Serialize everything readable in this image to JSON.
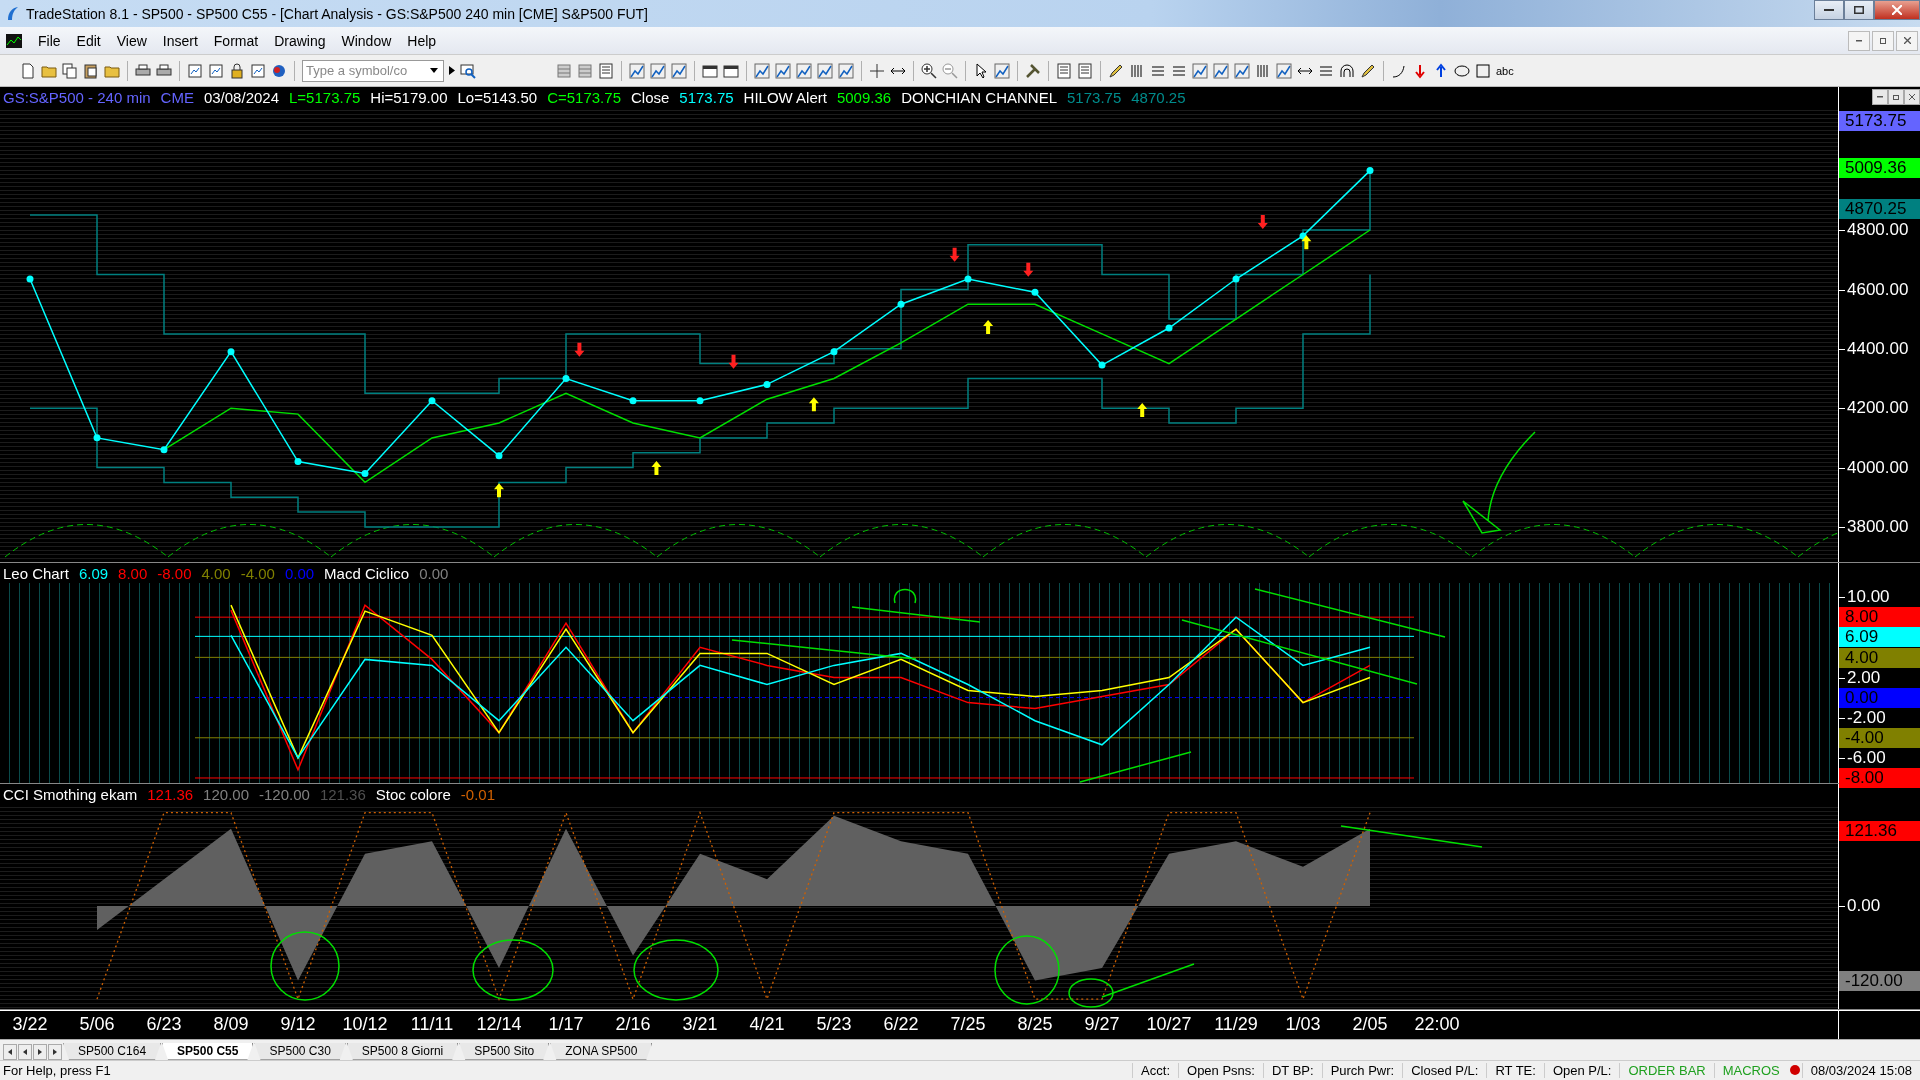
{
  "window": {
    "title": "TradeStation 8.1 - SP500 - SP500 C55 - [Chart Analysis - GS:S&P500  240 min  [CME] S&P500 FUT]"
  },
  "menu": [
    "File",
    "Edit",
    "View",
    "Insert",
    "Format",
    "Drawing",
    "Window",
    "Help"
  ],
  "toolbar": {
    "symbol_field": {
      "placeholder": "Type a symbol/co"
    },
    "text_tool": "abc"
  },
  "panes": [
    {
      "legend": [
        {
          "text": "GS:S&P500 - 240 min",
          "color": "#6464ff"
        },
        {
          "text": "CME",
          "color": "#6464ff"
        },
        {
          "text": "03/08/2024",
          "color": "#ffffff"
        },
        {
          "text": "L=5173.75",
          "color": "#00ff00"
        },
        {
          "text": "Hi=5179.00",
          "color": "#ffffff"
        },
        {
          "text": "Lo=5143.50",
          "color": "#ffffff"
        },
        {
          "text": "C=5173.75",
          "color": "#00ff00"
        },
        {
          "text": "Close",
          "color": "#ffffff"
        },
        {
          "text": "5173.75",
          "color": "#00ffff"
        },
        {
          "text": "HILOW Alert",
          "color": "#ffffff"
        },
        {
          "text": "5009.36",
          "color": "#00ff00"
        },
        {
          "text": "DONCHIAN CHANNEL",
          "color": "#ffffff"
        },
        {
          "text": "5173.75",
          "color": "#008c8c"
        },
        {
          "text": "4870.25",
          "color": "#008c8c"
        }
      ],
      "y_labels": [
        "4800.00",
        "4600.00",
        "4400.00",
        "4200.00",
        "4000.00",
        "3800.00"
      ],
      "badges": [
        {
          "text": "5173.75",
          "color": "#6464ff"
        },
        {
          "text": "5009.36",
          "color": "#00ff00"
        },
        {
          "text": "4870.25",
          "color": "#008080"
        }
      ]
    },
    {
      "legend": [
        {
          "text": "Leo Chart",
          "color": "#ffffff"
        },
        {
          "text": "6.09",
          "color": "#00ffff"
        },
        {
          "text": "8.00",
          "color": "#ff0000"
        },
        {
          "text": "-8.00",
          "color": "#ff0000"
        },
        {
          "text": "4.00",
          "color": "#808000"
        },
        {
          "text": "-4.00",
          "color": "#808000"
        },
        {
          "text": "0.00",
          "color": "#0000ff"
        },
        {
          "text": "Macd Ciclico",
          "color": "#ffffff"
        },
        {
          "text": "0.00",
          "color": "#808080"
        }
      ],
      "y_labels": [
        "10.00",
        "2.00",
        "-2.00",
        "-6.00"
      ],
      "badges": [
        {
          "text": "8.00",
          "color": "#ff0000"
        },
        {
          "text": "6.09",
          "color": "#00ffff"
        },
        {
          "text": "4.00",
          "color": "#808000"
        },
        {
          "text": "0.00",
          "color": "#0000ff"
        },
        {
          "text": "-4.00",
          "color": "#808000"
        },
        {
          "text": "-8.00",
          "color": "#ff0000"
        }
      ]
    },
    {
      "legend": [
        {
          "text": "CCI Smothing ekam",
          "color": "#ffffff"
        },
        {
          "text": "121.36",
          "color": "#ff0000"
        },
        {
          "text": "120.00",
          "color": "#808080"
        },
        {
          "text": "-120.00",
          "color": "#808080"
        },
        {
          "text": "121.36",
          "color": "#505050"
        },
        {
          "text": "Stoc colore",
          "color": "#ffffff"
        },
        {
          "text": "-0.01",
          "color": "#d06000"
        }
      ],
      "y_labels": [
        "0.00"
      ],
      "badges": [
        {
          "text": "121.36",
          "color": "#ff0000"
        },
        {
          "text": "-120.00",
          "color": "#808080"
        }
      ]
    }
  ],
  "x_labels": [
    "3/22",
    "5/06",
    "6/23",
    "8/09",
    "9/12",
    "10/12",
    "11/11",
    "12/14",
    "1/17",
    "2/16",
    "3/21",
    "4/21",
    "5/23",
    "6/22",
    "7/25",
    "8/25",
    "9/27",
    "10/27",
    "11/29",
    "1/03",
    "2/05",
    "22:00"
  ],
  "tabs": [
    {
      "label": "SP500 C164",
      "selected": false
    },
    {
      "label": "SP500 C55",
      "selected": true
    },
    {
      "label": "SP500 C30",
      "selected": false
    },
    {
      "label": "SP500 8 Giorni",
      "selected": false
    },
    {
      "label": "SP500 Sito",
      "selected": false
    },
    {
      "label": "ZONA SP500",
      "selected": false
    }
  ],
  "status_bar": {
    "help": "For Help, press F1",
    "fields": [
      "Acct:",
      "Open Psns:",
      "DT BP:",
      "Purch Pwr:",
      "Closed P/L:",
      "RT TE:",
      "Open P/L:"
    ],
    "order_bar": "ORDER BAR",
    "macros": "MACROS",
    "datetime": "08/03/2024 15:08"
  }
}
